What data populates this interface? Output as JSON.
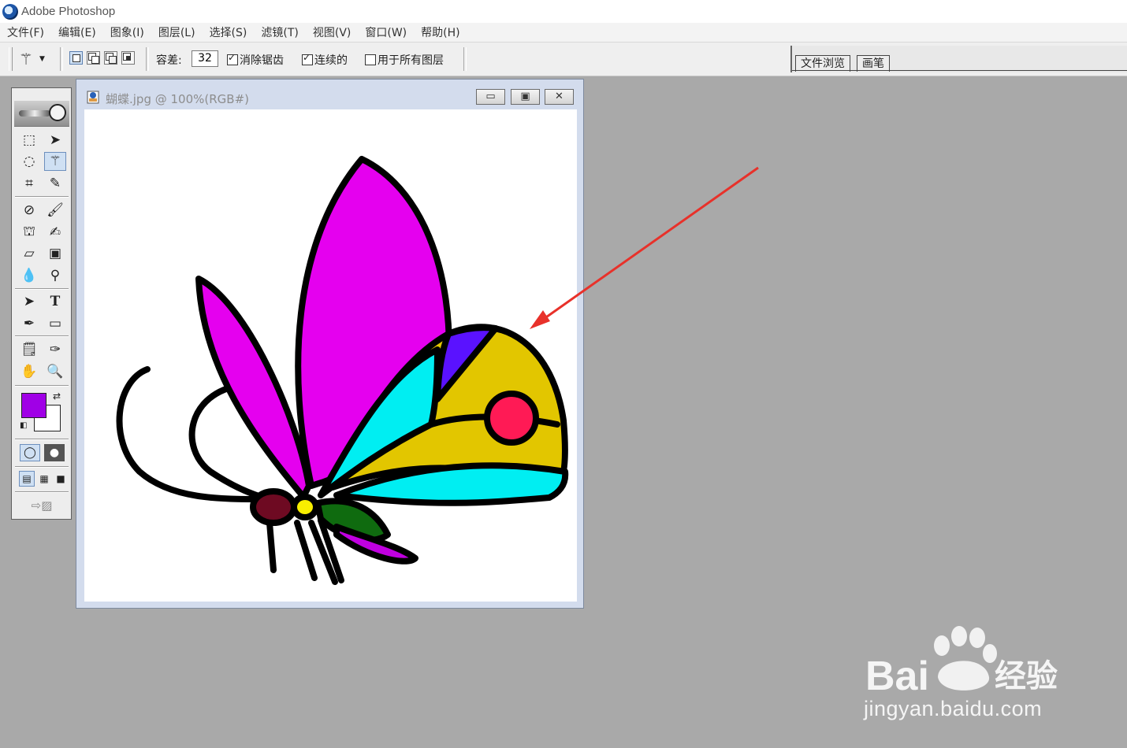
{
  "app": {
    "title": "Adobe Photoshop"
  },
  "menu": {
    "items": [
      "文件(F)",
      "编辑(E)",
      "图象(I)",
      "图层(L)",
      "选择(S)",
      "滤镜(T)",
      "视图(V)",
      "窗口(W)",
      "帮助(H)"
    ]
  },
  "options": {
    "tolerance_label": "容差:",
    "tolerance_value": "32",
    "anti_alias_label": "消除锯齿",
    "anti_alias_checked": true,
    "contiguous_label": "连续的",
    "contiguous_checked": true,
    "all_layers_label": "用于所有图层",
    "all_layers_checked": false
  },
  "palette_well": {
    "tabs": [
      "文件浏览",
      "画笔"
    ]
  },
  "toolbox": {
    "foreground_color": "#a000e6",
    "background_color": "#ffffff",
    "active_tool": "magic-wand"
  },
  "document": {
    "title": "蝴蝶.jpg @ 100%(RGB#)"
  },
  "watermark": {
    "text": "jingyan.baidu.com",
    "logo_text": "Bai du 经验"
  },
  "colors": {
    "workspace": "#a9a9a9",
    "annotation_arrow": "#e8312a"
  }
}
